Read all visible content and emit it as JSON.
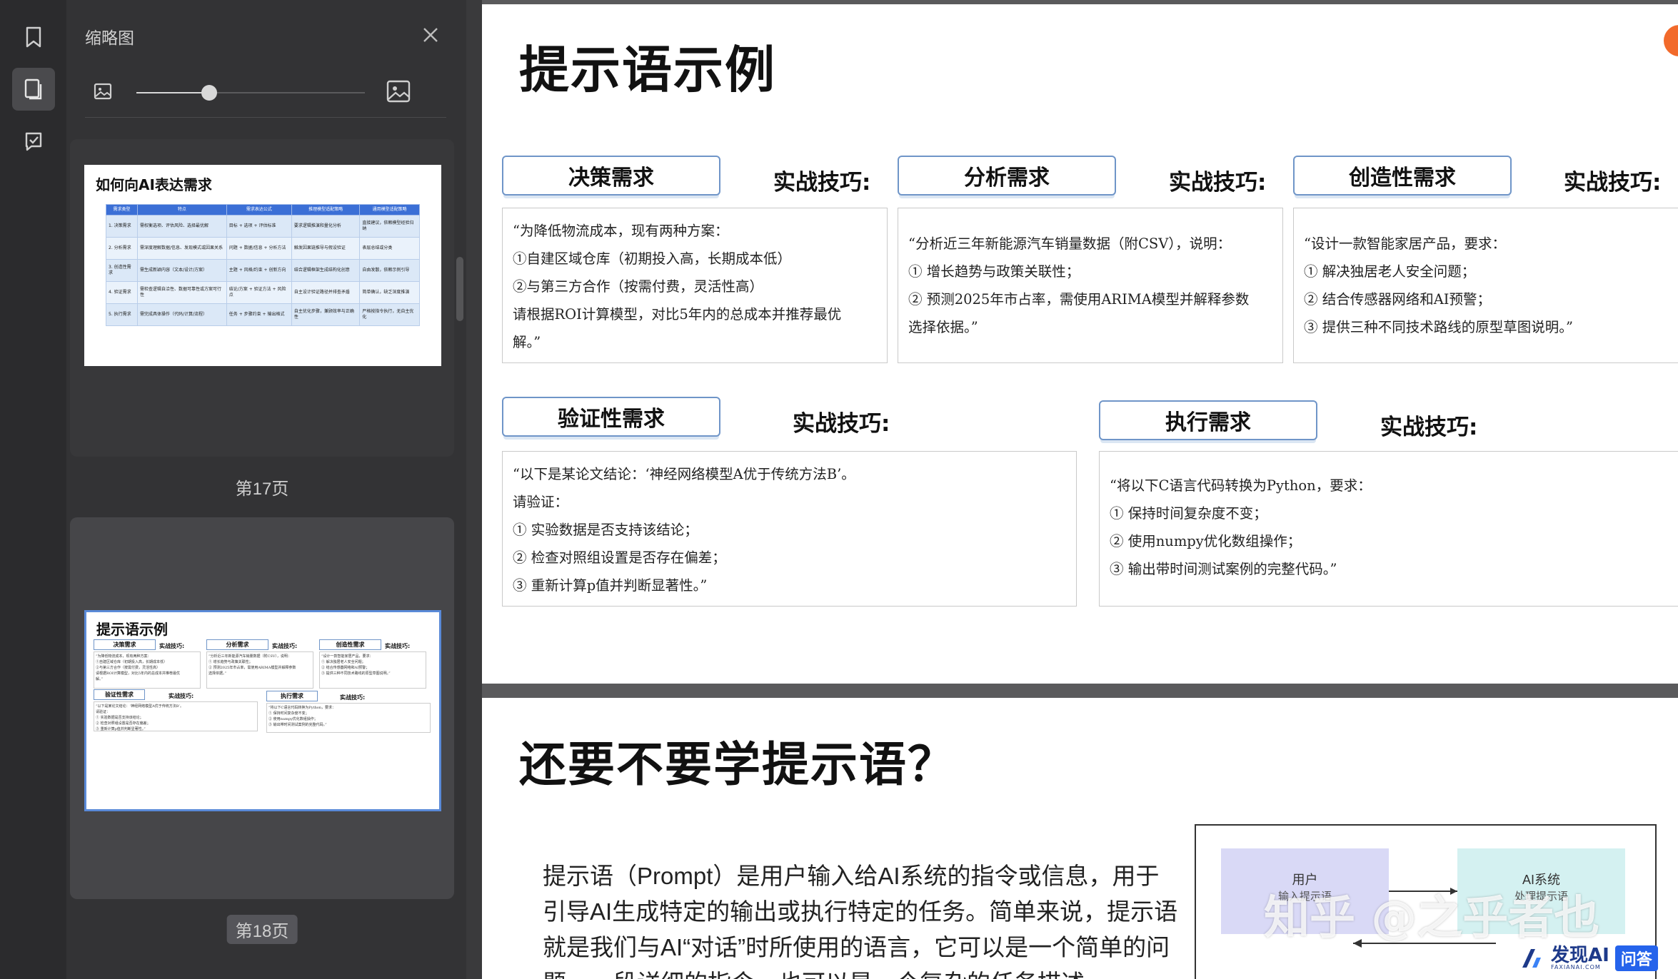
{
  "sidebar": {
    "title": "缩略图",
    "zoom_fraction": 0.32,
    "pages": [
      {
        "label": "第17页",
        "thumb_title": "如何向AI表达需求"
      },
      {
        "label": "第18页",
        "thumb_title": "提示语示例",
        "selected": true
      }
    ]
  },
  "thumb17": {
    "header": [
      "需求类型",
      "特点",
      "需求表达公式",
      "推理模型适配策略",
      "通用模型适配策略"
    ],
    "rows": [
      [
        "1. 决策需求",
        "需权衡选项、评估风险、选择最优解",
        "目标 + 选项 + 评估标准",
        "要求逻辑推演和量化分析",
        "直接建议，依赖模型经验归纳"
      ],
      [
        "2. 分析需求",
        "需深度理解数据/信息、发现模式或因果关系",
        "问题 + 数据/信息 + 分析方法",
        "触发因果链推导与假设验证",
        "表层总结或分类"
      ],
      [
        "3. 创造性需求",
        "需生成新颖内容（文本/设计/方案）",
        "主题 + 风格/约束 + 创新方向",
        "结合逻辑框架生成结构化创意",
        "自由发散，依赖示例引导"
      ],
      [
        "4. 验证需求",
        "需检查逻辑自洽性、数据可靠性或方案可行性",
        "结论/方案 + 验证方法 + 风险点",
        "自主设计验证路径并排查矛盾",
        "简单确认，缺乏深度推演"
      ],
      [
        "5. 执行需求",
        "需完成具体操作（代码/计算/流程）",
        "任务 + 步骤约束 + 输出格式",
        "自主优化步骤，兼顾效率与正确性",
        "严格按指令执行，无自主优化"
      ]
    ]
  },
  "slide18": {
    "title": "提示语示例",
    "skill_label": "实战技巧:",
    "cards": [
      {
        "tag": "决策需求",
        "lines": [
          "“为降低物流成本，现有两种方案：",
          "①自建区域仓库（初期投入高，长期成本低）",
          "②与第三方合作（按需付费，灵活性高）",
          "请根据ROI计算模型，对比5年内的总成本并推荐最优",
          "解。”"
        ]
      },
      {
        "tag": "分析需求",
        "lines": [
          "“分析近三年新能源汽车销量数据（附CSV），说明：",
          "① 增长趋势与政策关联性；",
          "② 预测2025年市占率，需使用ARIMA模型并解释参数",
          "选择依据。”"
        ]
      },
      {
        "tag": "创造性需求",
        "lines": [
          "“设计一款智能家居产品，要求：",
          "① 解决独居老人安全问题；",
          "② 结合传感器网络和AI预警；",
          "③ 提供三种不同技术路线的原型草图说明。”"
        ]
      },
      {
        "tag": "验证性需求",
        "lines": [
          "“以下是某论文结论：‘神经网络模型A优于传统方法B’。",
          "请验证：",
          "① 实验数据是否支持该结论；",
          "② 检查对照组设置是否存在偏差；",
          "③ 重新计算p值并判断显著性。”"
        ]
      },
      {
        "tag": "执行需求",
        "lines": [
          "“将以下C语言代码转换为Python，要求：",
          "① 保持时间复杂度不变；",
          "② 使用numpy优化数组操作；",
          "③ 输出带时间测试案例的完整代码。”"
        ]
      }
    ]
  },
  "slide19": {
    "title": "还要不要学提示语？",
    "para_lines": [
      "提示语（Prompt）是用户输入给AI系统的指令或信息，用于",
      "引导AI生成特定的输出或执行特定的任务。简单来说，提示语",
      "就是我们与AI“对话”时所使用的语言，它可以是一个简单的问",
      "题，一段详细的指令，也可以是一个复杂的任务描述。"
    ],
    "diagram": {
      "user": "用户",
      "user_sub": "输入提示语",
      "ai": "AI系统",
      "ai_sub": "处理提示语",
      "user_color": "#d9d9f6",
      "ai_color": "#d4f1f1"
    }
  },
  "overlay": {
    "watermark": "知乎 @之乎者也",
    "brand": "发现AI",
    "brand_sub": "FAXIANAI.COM",
    "brand_badge": "问答"
  }
}
